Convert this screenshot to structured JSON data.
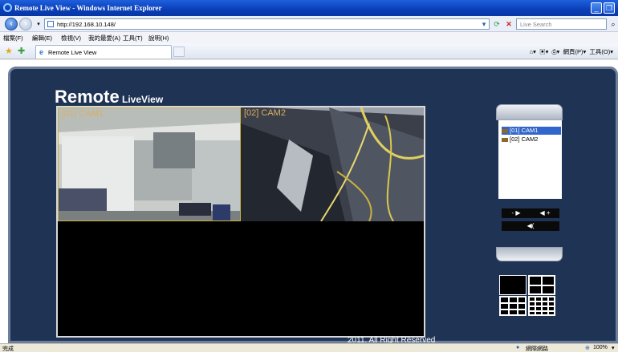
{
  "window": {
    "title": "Remote Live View - Windows Internet Explorer"
  },
  "address": {
    "url": "http://192.168.10.148/"
  },
  "search": {
    "placeholder": "Live Search"
  },
  "menu": [
    "檔案(F)",
    "編輯(E)",
    "檢視(V)",
    "我的最愛(A)",
    "工具(T)",
    "說明(H)"
  ],
  "tab": {
    "label": "Remote Live View"
  },
  "command_bar": {
    "page": "網頁(P)",
    "tools": "工具(O)"
  },
  "brand": {
    "big": "Remote",
    "small": " LiveView"
  },
  "cameras": [
    {
      "label": "[01]  CAM1"
    },
    {
      "label": "[02]  CAM2"
    }
  ],
  "camera_list": [
    {
      "label": "[01] CAM1",
      "selected": true
    },
    {
      "label": "[02] CAM2",
      "selected": false
    }
  ],
  "footer": {
    "copyright": "2011. All Right Reserved"
  },
  "status": {
    "left": "完成",
    "zone": "網際網路",
    "zoom": "100%"
  }
}
